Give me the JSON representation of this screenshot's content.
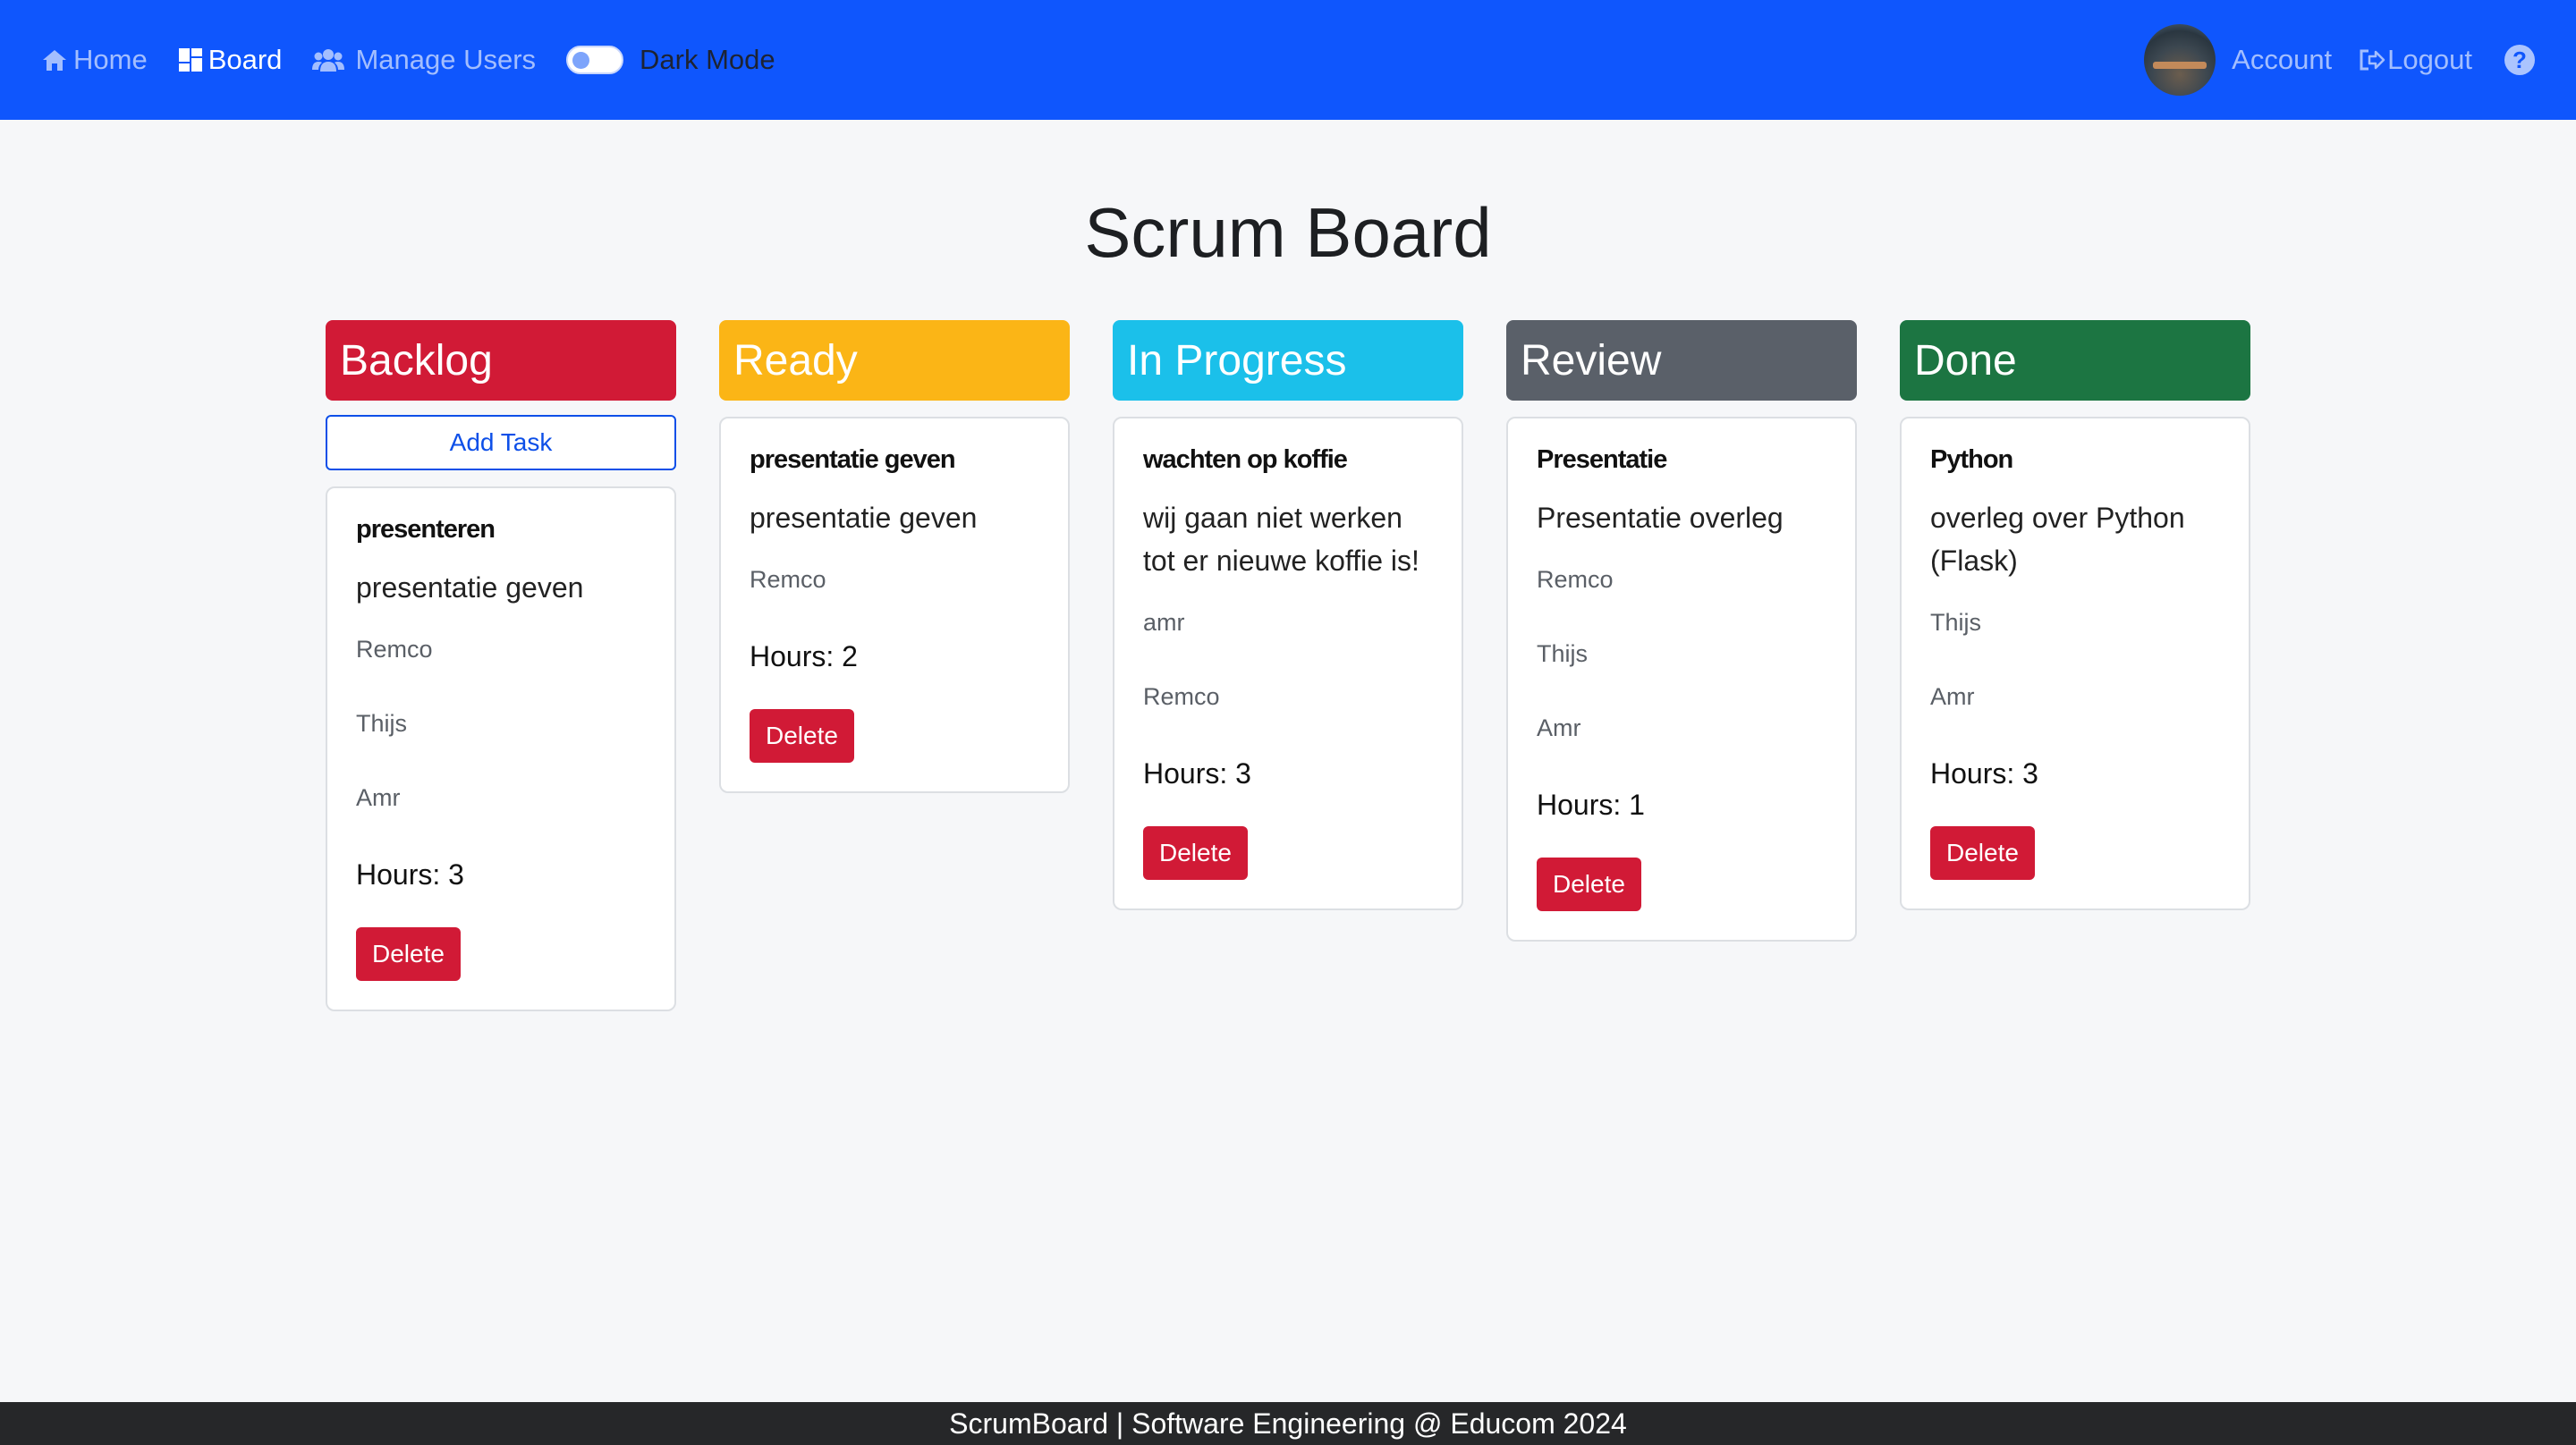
{
  "nav": {
    "home_label": "Home",
    "board_label": "Board",
    "manage_users_label": "Manage Users",
    "dark_mode_label": "Dark Mode",
    "account_label": "Account",
    "logout_label": "Logout",
    "help_glyph": "?",
    "brand_color": "#0f56fd"
  },
  "page": {
    "title": "Scrum Board",
    "add_task_label": "Add Task",
    "delete_label": "Delete"
  },
  "columns": [
    {
      "name": "Backlog",
      "color": "#d11a36",
      "tasks": [
        {
          "title": "presenteren",
          "description": "presentatie geven",
          "users": [
            "Remco",
            "Thijs",
            "Amr"
          ],
          "hours": "Hours: 3"
        }
      ]
    },
    {
      "name": "Ready",
      "color": "#fbb516",
      "tasks": [
        {
          "title": "presentatie geven",
          "description": "presentatie geven",
          "users": [
            "Remco"
          ],
          "hours": "Hours: 2"
        }
      ]
    },
    {
      "name": "In Progress",
      "color": "#1bc0ea",
      "tasks": [
        {
          "title": "wachten op koffie",
          "description": "wij gaan niet werken tot er nieuwe koffie is!",
          "users": [
            "amr",
            "Remco"
          ],
          "hours": "Hours: 3"
        }
      ]
    },
    {
      "name": "Review",
      "color": "#5a6069",
      "tasks": [
        {
          "title": "Presentatie",
          "description": "Presentatie overleg",
          "users": [
            "Remco",
            "Thijs",
            "Amr"
          ],
          "hours": "Hours: 1"
        }
      ]
    },
    {
      "name": "Done",
      "color": "#1c7542",
      "tasks": [
        {
          "title": "Python",
          "description": "overleg over Python (Flask)",
          "users": [
            "Thijs",
            "Amr"
          ],
          "hours": "Hours: 3"
        }
      ]
    }
  ],
  "footer": {
    "text": "ScrumBoard | Software Engineering @ Educom 2024"
  }
}
